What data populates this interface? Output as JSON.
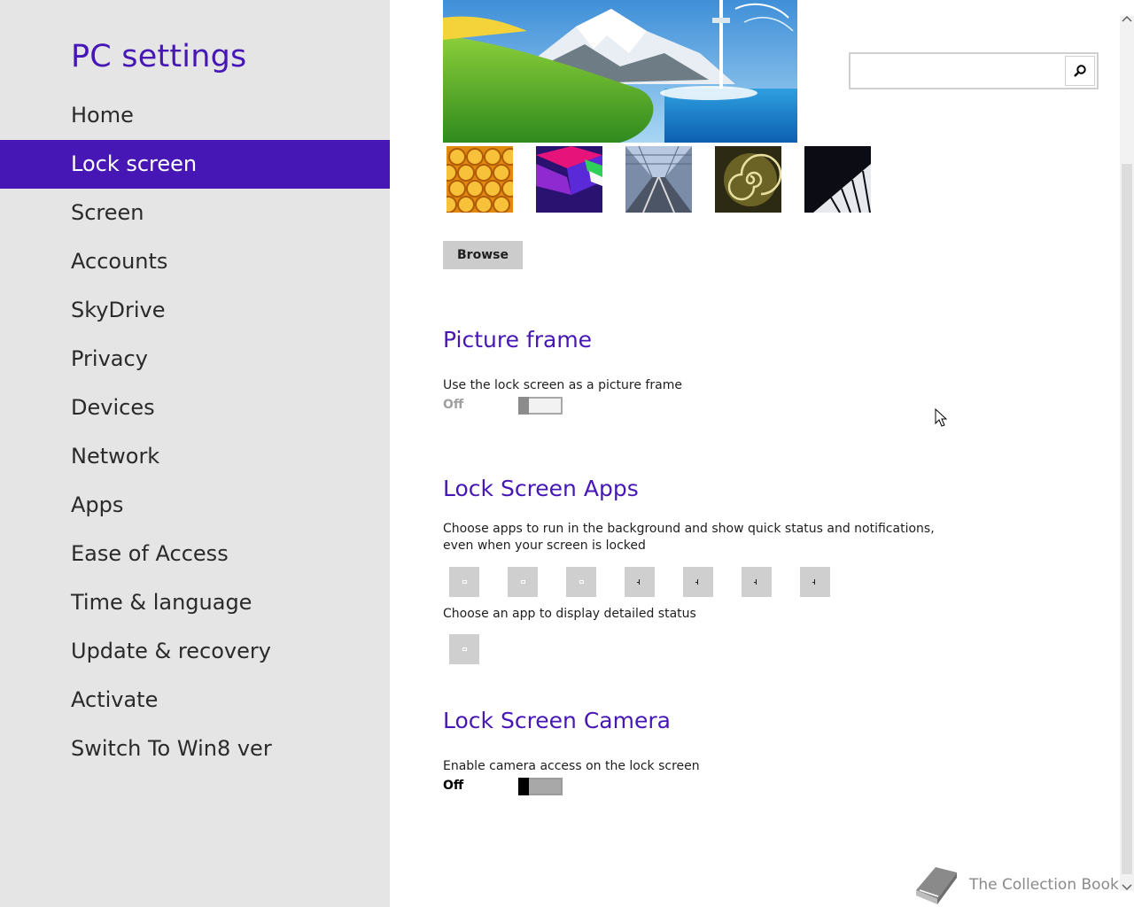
{
  "sidebar": {
    "title": "PC settings",
    "items": [
      {
        "label": "Home",
        "active": false
      },
      {
        "label": "Lock screen",
        "active": true
      },
      {
        "label": "Screen",
        "active": false
      },
      {
        "label": "Accounts",
        "active": false
      },
      {
        "label": "SkyDrive",
        "active": false
      },
      {
        "label": "Privacy",
        "active": false
      },
      {
        "label": "Devices",
        "active": false
      },
      {
        "label": "Network",
        "active": false
      },
      {
        "label": "Apps",
        "active": false
      },
      {
        "label": "Ease of Access",
        "active": false
      },
      {
        "label": "Time & language",
        "active": false
      },
      {
        "label": "Update & recovery",
        "active": false
      },
      {
        "label": "Activate",
        "active": false
      },
      {
        "label": "Switch To Win8 ver",
        "active": false
      }
    ]
  },
  "preview": {
    "browse_label": "Browse"
  },
  "picture_frame": {
    "heading": "Picture frame",
    "label": "Use the lock screen as a picture frame",
    "state": "Off"
  },
  "lock_screen_apps": {
    "heading": "Lock Screen Apps",
    "description": "Choose apps to run in the background and show quick status and notifications, even when your screen is locked",
    "detailed_label": "Choose an app to display detailed status"
  },
  "lock_screen_camera": {
    "heading": "Lock Screen Camera",
    "label": "Enable camera access on the lock screen",
    "state": "Off"
  },
  "search": {
    "placeholder": "",
    "value": ""
  },
  "watermark": {
    "text": "The Collection Book"
  },
  "colors": {
    "accent": "#4617b4",
    "sidebar_bg": "#e5e5e5"
  }
}
